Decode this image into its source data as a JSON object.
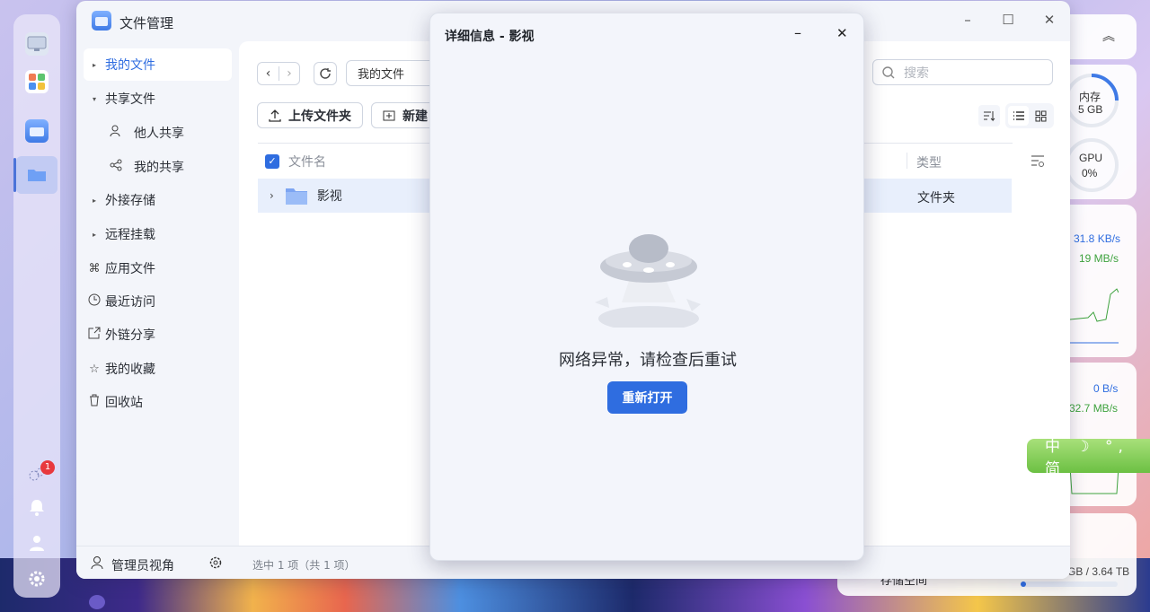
{
  "window": {
    "title": "文件管理",
    "controls": {
      "minimize": "–",
      "maximize": "☐",
      "close": "✕"
    }
  },
  "sidebar": {
    "items": [
      {
        "label": "我的文件"
      },
      {
        "label": "共享文件"
      },
      {
        "label": "他人共享"
      },
      {
        "label": "我的共享"
      },
      {
        "label": "外接存储"
      },
      {
        "label": "远程挂载"
      },
      {
        "label": "应用文件"
      },
      {
        "label": "最近访问"
      },
      {
        "label": "外链分享"
      },
      {
        "label": "我的收藏"
      },
      {
        "label": "回收站"
      }
    ],
    "footer_label": "管理员视角"
  },
  "toolbar": {
    "path": "我的文件",
    "upload_label": "上传文件夹",
    "new_label": "新建",
    "search_placeholder": "搜索"
  },
  "table": {
    "col_name": "文件名",
    "col_type": "类型",
    "rows": [
      {
        "name": "影视",
        "type": "文件夹"
      }
    ]
  },
  "status": {
    "selection": "选中 1 项（共 1 项）"
  },
  "dialog": {
    "title": "详细信息 - 影视",
    "message": "网络异常，请检查后重试",
    "reopen_label": "重新打开"
  },
  "widgets": {
    "mem_label": "内存",
    "mem_value": "5 GB",
    "gpu_label": "GPU",
    "gpu_value": "0%",
    "net_up": "31.8 KB/s",
    "net_down": "19 MB/s",
    "disk_io_a": "0 B/s",
    "disk_io_b": "32.7 MB/s",
    "storage_text": "GB / 3.64 TB",
    "storage_label": "存储空间"
  },
  "dock": {
    "badge_count": "1"
  },
  "ime": {
    "text": "中 ☽ °, 简"
  }
}
